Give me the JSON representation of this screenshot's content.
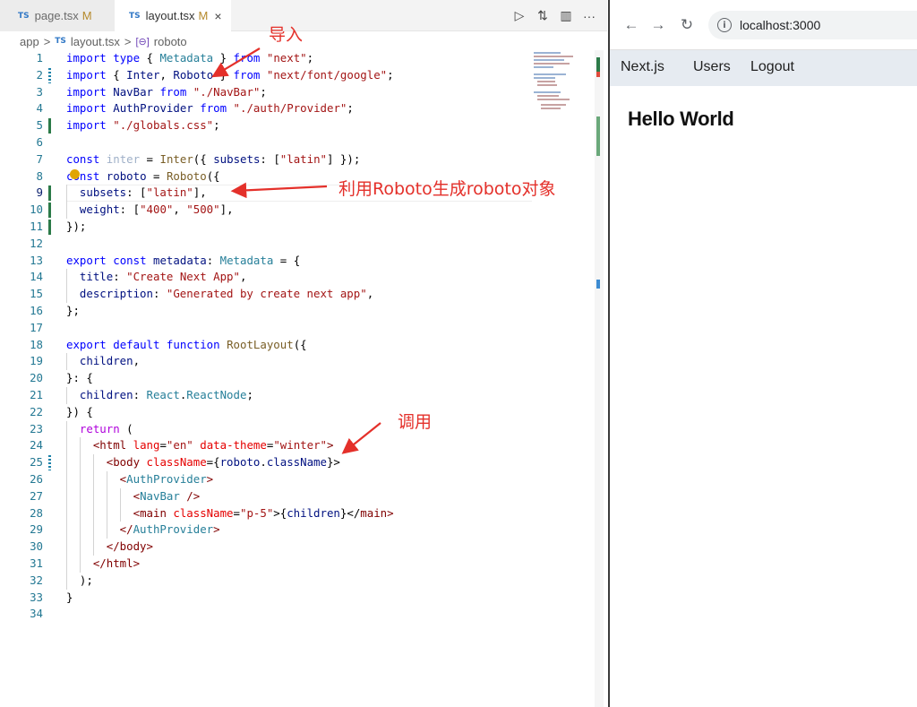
{
  "editor": {
    "tabs": [
      {
        "lang": "TS",
        "name": "page.tsx",
        "status": "M"
      },
      {
        "lang": "TS",
        "name": "layout.tsx",
        "status": "M",
        "close": "×"
      }
    ],
    "actions": [
      "▷",
      "⇅",
      "▥",
      "···"
    ],
    "breadcrumb": {
      "folder": "app",
      "sep": ">",
      "lang": "TS",
      "file": "layout.tsx",
      "symbol_icon": "[⊖]",
      "symbol": "roboto"
    },
    "line_numbers": [
      "1",
      "2",
      "3",
      "4",
      "5",
      "6",
      "7",
      "8",
      "9",
      "10",
      "11",
      "12",
      "13",
      "14",
      "15",
      "16",
      "17",
      "18",
      "19",
      "20",
      "21",
      "22",
      "23",
      "24",
      "25",
      "26",
      "27",
      "28",
      "29",
      "30",
      "31",
      "32",
      "33",
      "34"
    ],
    "code": {
      "l1": [
        "import",
        " ",
        "type",
        " { ",
        "Metadata",
        " } ",
        "from",
        " ",
        "\"next\"",
        ";"
      ],
      "l2": [
        "import",
        " { ",
        "Inter",
        ", ",
        "Roboto",
        " } ",
        "from",
        " ",
        "\"next/font/google\"",
        ";"
      ],
      "l3": [
        "import",
        " ",
        "NavBar",
        " ",
        "from",
        " ",
        "\"./NavBar\"",
        ";"
      ],
      "l4": [
        "import",
        " ",
        "AuthProvider",
        " ",
        "from",
        " ",
        "\"./auth/Provider\"",
        ";"
      ],
      "l5": [
        "import",
        " ",
        "\"./globals.css\"",
        ";"
      ],
      "l7": [
        "const",
        " ",
        "inter",
        " = ",
        "Inter",
        "({ ",
        "subsets",
        ": [",
        "\"latin\"",
        "] });"
      ],
      "l8": [
        "const",
        " ",
        "roboto",
        " = ",
        "Roboto",
        "({"
      ],
      "l9": [
        "subsets",
        ": [",
        "\"latin\"",
        "],"
      ],
      "l10": [
        "weight",
        ": [",
        "\"400\"",
        ", ",
        "\"500\"",
        "],"
      ],
      "l11": [
        "});"
      ],
      "l13": [
        "export",
        " ",
        "const",
        " ",
        "metadata",
        ": ",
        "Metadata",
        " = {"
      ],
      "l14": [
        "title",
        ": ",
        "\"Create Next App\"",
        ","
      ],
      "l15": [
        "description",
        ": ",
        "\"Generated by create next app\"",
        ","
      ],
      "l16": [
        "};"
      ],
      "l18": [
        "export",
        " ",
        "default",
        " ",
        "function",
        " ",
        "RootLayout",
        "({"
      ],
      "l19": [
        "children",
        ","
      ],
      "l20": [
        "}: {"
      ],
      "l21": [
        "children",
        ": ",
        "React",
        ".",
        "ReactNode",
        ";"
      ],
      "l22": [
        "}) {"
      ],
      "l23": [
        "return",
        " ("
      ],
      "l24": [
        "<",
        "html",
        " ",
        "lang",
        "=",
        "\"en\"",
        " ",
        "data-theme",
        "=",
        "\"winter\"",
        ">"
      ],
      "l25": [
        "<",
        "body",
        " ",
        "className",
        "={",
        "roboto",
        ".",
        "className",
        "}>"
      ],
      "l26": [
        "<",
        "AuthProvider",
        ">"
      ],
      "l27": [
        "<",
        "NavBar",
        " />"
      ],
      "l28": [
        "<",
        "main",
        " ",
        "className",
        "=",
        "\"p-5\"",
        ">{",
        "children",
        "}</",
        "main",
        ">"
      ],
      "l29": [
        "</",
        "AuthProvider",
        ">"
      ],
      "l30": [
        "</",
        "body",
        ">"
      ],
      "l31": [
        "</",
        "html",
        ">"
      ],
      "l32": [
        ");"
      ],
      "l33": [
        "}"
      ]
    },
    "annotations": {
      "import_note": "导入",
      "roboto_note": "利用Roboto生成roboto对象",
      "call_note": "调用"
    },
    "colors": {
      "annotation": "#e4302a",
      "keyword": "#0000ff",
      "string": "#a31515"
    }
  },
  "browser": {
    "nav_icons": [
      "back-arrow-icon",
      "forward-arrow-icon",
      "reload-icon"
    ],
    "back": "←",
    "forward": "→",
    "reload": "↻",
    "info_icon": "i",
    "url": "localhost:3000",
    "app_nav": {
      "brand": "Next.js",
      "users": "Users",
      "logout": "Logout"
    },
    "heading": "Hello World"
  }
}
